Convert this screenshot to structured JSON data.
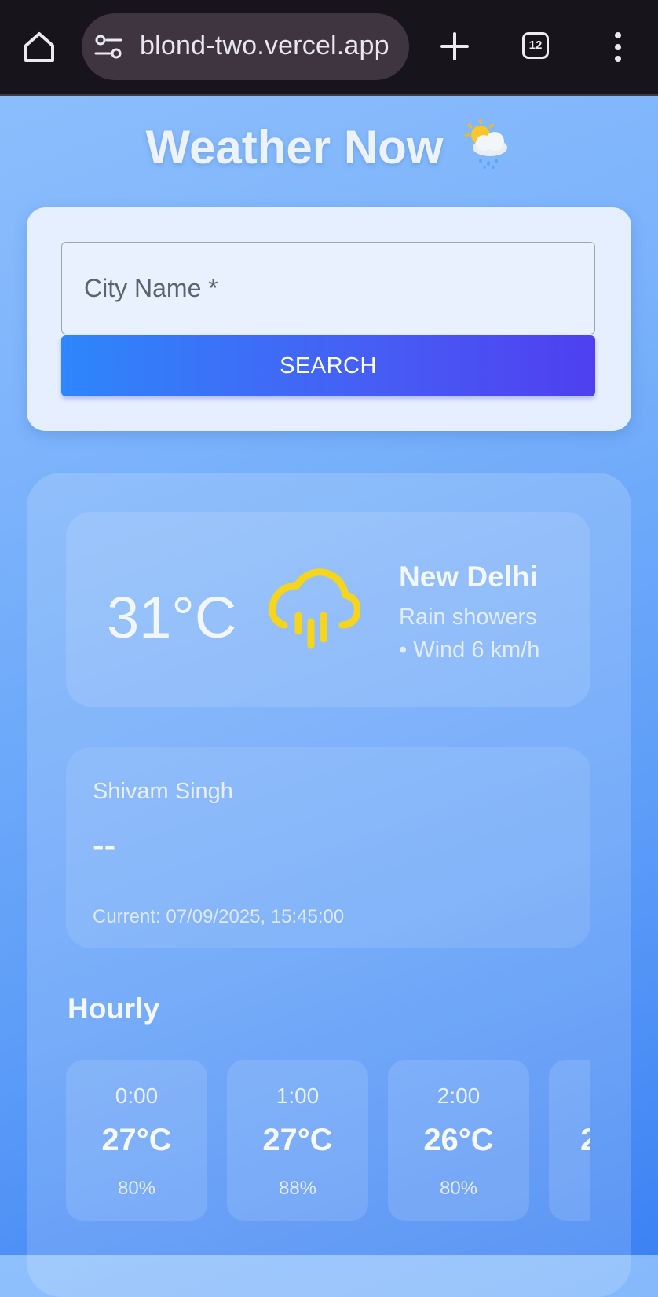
{
  "browser": {
    "url": "blond-two.vercel.app",
    "tab_count": "12"
  },
  "app": {
    "title": "Weather Now"
  },
  "search": {
    "placeholder": "City Name *",
    "value": "",
    "button_label": "SEARCH"
  },
  "current": {
    "temperature": "31°C",
    "city": "New Delhi",
    "condition": "Rain showers",
    "wind": "• Wind 6 km/h",
    "icon": "rain-cloud-icon",
    "icon_color": "#f7d51d"
  },
  "user": {
    "name": "Shivam Singh",
    "value": "--",
    "current_time": "Current: 07/09/2025, 15:45:00"
  },
  "hourly": {
    "title": "Hourly",
    "items": [
      {
        "time": "0:00",
        "temp": "27°C",
        "humidity": "80%"
      },
      {
        "time": "1:00",
        "temp": "27°C",
        "humidity": "88%"
      },
      {
        "time": "2:00",
        "temp": "26°C",
        "humidity": "80%"
      },
      {
        "time": "",
        "temp": "2",
        "humidity": ""
      }
    ]
  },
  "colors": {
    "button_gradient_start": "#2e86fb",
    "button_gradient_end": "#4f3ff0",
    "background_top": "#8fc0fc",
    "background_bottom": "#3d82f3"
  }
}
